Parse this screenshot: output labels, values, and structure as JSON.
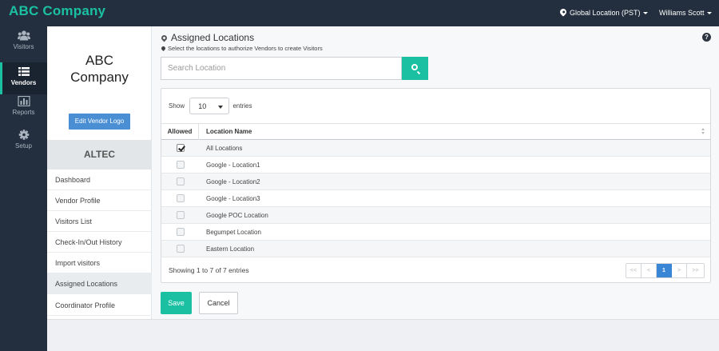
{
  "app": {
    "brand": "ABC Company"
  },
  "header": {
    "location": "Global Location (PST)",
    "user": "Williams Scott"
  },
  "sidenav": [
    {
      "label": "Visitors",
      "icon": "users-icon"
    },
    {
      "label": "Vendors",
      "icon": "list-icon",
      "active": true
    },
    {
      "label": "Reports",
      "icon": "bar-chart-icon"
    },
    {
      "label": "Setup",
      "icon": "gear-icon"
    }
  ],
  "vendor": {
    "name_line1": "ABC",
    "name_line2": "Company",
    "logo_button": "Edit Vendor Logo",
    "code": "ALTEC",
    "menu": [
      "Dashboard",
      "Vendor Profile",
      "Visitors List",
      "Check-In/Out History",
      "Import visitors",
      "Assigned Locations",
      "Coordinator Profile"
    ]
  },
  "main": {
    "title": "Assigned Locations",
    "subtitle": "Select the locations to authorize Vendors to create Visitors",
    "search_placeholder": "Search Location",
    "length": {
      "show": "Show",
      "value": "10",
      "entries": "entries"
    },
    "columns": {
      "allowed": "Allowed",
      "location": "Location Name"
    },
    "rows": [
      {
        "name": "All Locations",
        "checked": true
      },
      {
        "name": "Google - Location1",
        "checked": false
      },
      {
        "name": "Google - Location2",
        "checked": false
      },
      {
        "name": "Google - Location3",
        "checked": false
      },
      {
        "name": "Google POC Location",
        "checked": false
      },
      {
        "name": "Begumpet Location",
        "checked": false
      },
      {
        "name": "Eastern Location",
        "checked": false
      }
    ],
    "info": "Showing 1 to 7 of 7 entries",
    "pager": {
      "first": "<<",
      "prev": "<",
      "current": "1",
      "next": ">",
      "last": ">>"
    },
    "save": "Save",
    "cancel": "Cancel"
  },
  "colors": {
    "accent": "#1bc0a2",
    "nav_bg": "#232f3e",
    "primary": "#3a86d6"
  }
}
